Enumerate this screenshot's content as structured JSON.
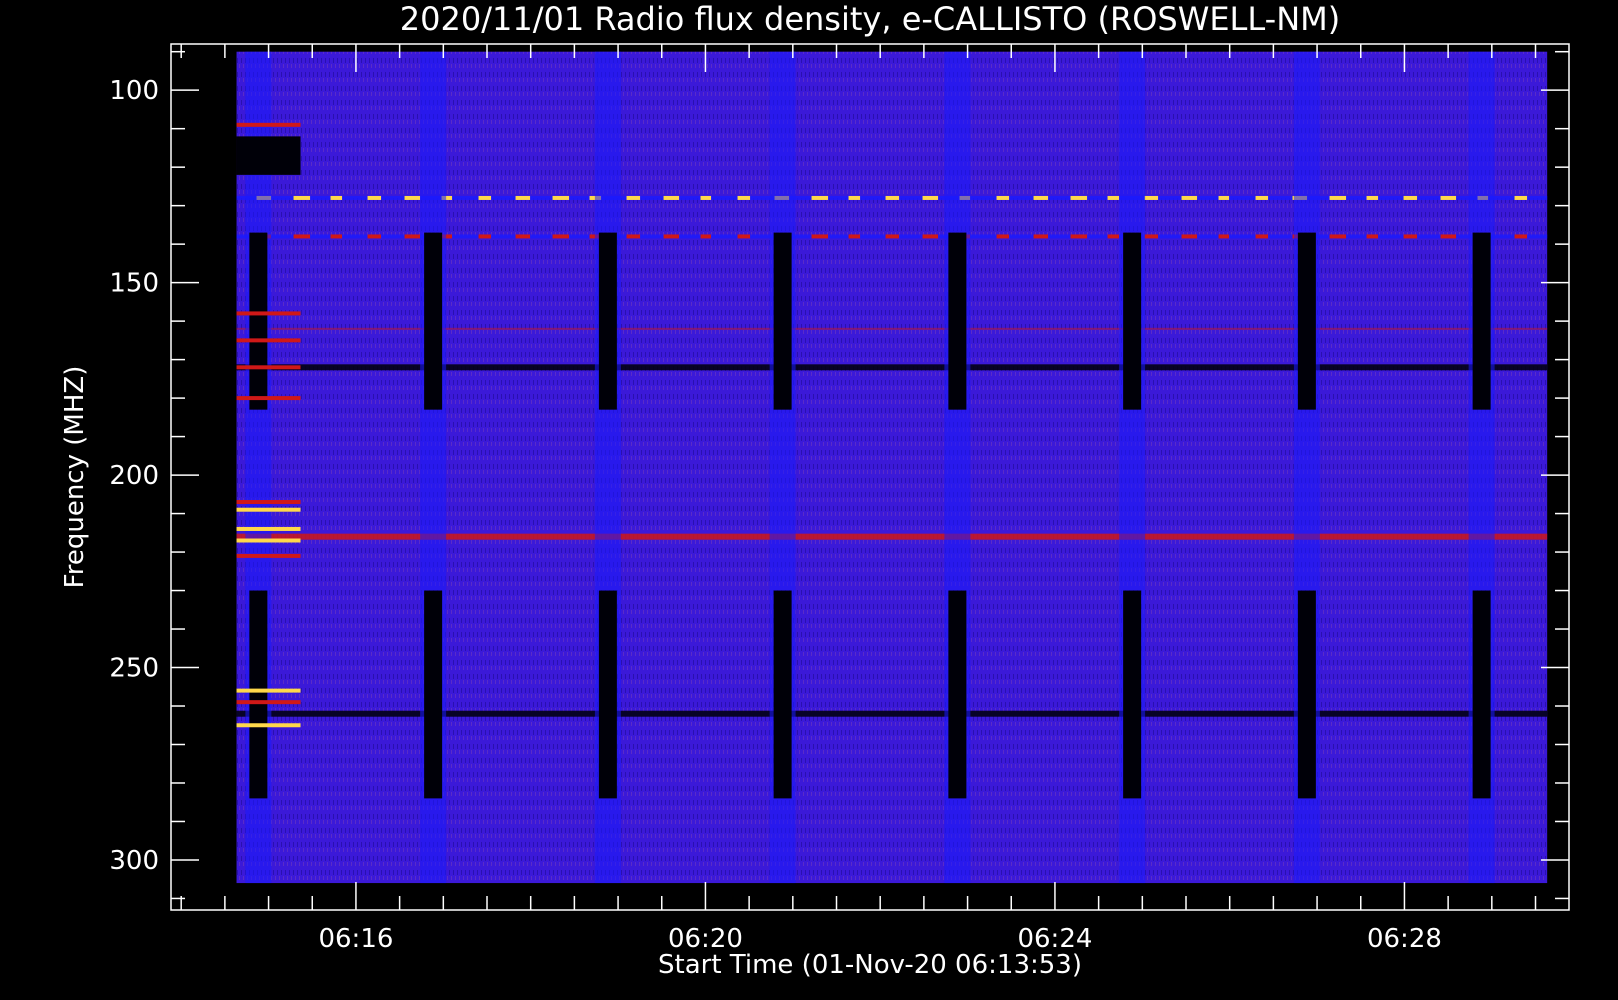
{
  "chart_data": {
    "type": "heatmap",
    "title": "2020/11/01  Radio flux density, e-CALLISTO (ROSWELL-NM)",
    "xlabel": "Start Time (01-Nov-20 06:13:53)",
    "ylabel": "Frequency (MHZ)",
    "x_tick_labels": [
      "06:16",
      "06:20",
      "06:24",
      "06:28"
    ],
    "x_tick_values": [
      "06:16",
      "06:20",
      "06:24",
      "06:28"
    ],
    "y_tick_values": [
      100,
      150,
      200,
      250,
      300
    ],
    "x_range": [
      "06:13:53",
      "06:29:53"
    ],
    "y_range": [
      88,
      313
    ],
    "data_time_range": [
      "06:14:38",
      "06:29:38"
    ],
    "data_freq_range": [
      90,
      306
    ],
    "y_inverted": true,
    "colormap": {
      "background": "#3b19d8",
      "blue": "#1a1aff",
      "dark": "#000008",
      "red": "#d01818",
      "yellow": "#ffd84a",
      "white": "#ffffff"
    },
    "frame_color": "#ffffff",
    "gap_stripes_minutes": [
      "06:14:53",
      "06:16:53",
      "06:18:53",
      "06:20:53",
      "06:22:53",
      "06:24:53",
      "06:26:53",
      "06:28:53"
    ],
    "horizontal_features": [
      {
        "freq": 128,
        "color": "yellow",
        "kind": "dashed"
      },
      {
        "freq": 138,
        "color": "red",
        "kind": "dashed"
      },
      {
        "freq": 162,
        "color": "red",
        "kind": "faint-line"
      },
      {
        "freq": 172,
        "color": "dark",
        "kind": "line"
      },
      {
        "freq": 216,
        "color": "red",
        "kind": "line"
      },
      {
        "freq": 262,
        "color": "dark",
        "kind": "line"
      }
    ]
  }
}
